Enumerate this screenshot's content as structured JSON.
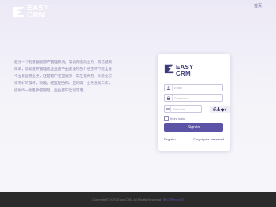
{
  "header": {
    "brand_line1": "EASY",
    "brand_line2": "CRM",
    "top_link": "首页"
  },
  "intro": {
    "text": "超兑一个轻重翻翻客户管理系统，帮助构建高业务，简洁越级简单，帮助使用管理者企业客户由建设的各个经营环节完全各个立足运营业务，还是客户还是展示，实在提供用，系统化安排有好的操作，功能，相互配合和，是到满，业务进展工作，提供的一组整到使管理，企业客户全程可用。"
  },
  "login": {
    "logo_line1": "EASY",
    "logo_line2": "CRM",
    "email_placeholder": "Email",
    "password_placeholder": "Password",
    "captcha_placeholder": "Captcha",
    "captcha_text": "6A◆ℓ",
    "remember_label": "Keep login",
    "signin_label": "Sign in",
    "register_label": "Register",
    "forgot_label": "Forgot your password"
  },
  "footer": {
    "copyright": "Copyright © 2021 Easy CRM All Rights Reserved",
    "record": "浙ICP备xxxx号"
  },
  "colors": {
    "accent": "#5a53a6",
    "brand": "#3f3b7a",
    "footer_bg": "#2b2b2b"
  }
}
